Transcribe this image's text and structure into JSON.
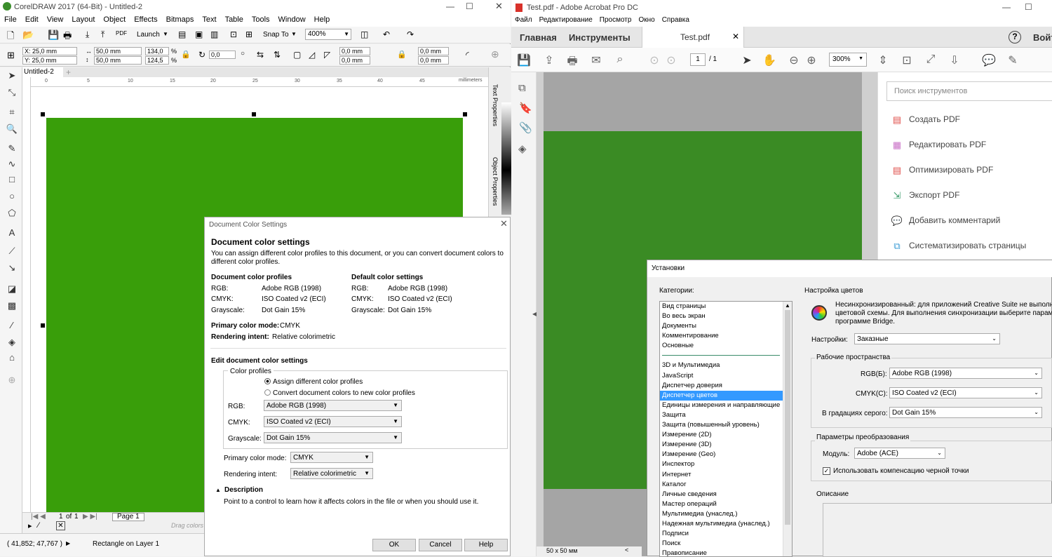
{
  "corel": {
    "title": "CorelDRAW 2017 (64-Bit) - Untitled-2",
    "menu": [
      "File",
      "Edit",
      "View",
      "Layout",
      "Object",
      "Effects",
      "Bitmaps",
      "Text",
      "Table",
      "Tools",
      "Window",
      "Help"
    ],
    "toolbar": {
      "launch": "Launch",
      "snap_to": "Snap To",
      "zoom": "400%"
    },
    "props": {
      "x": "X: 25,0 mm",
      "y": "Y: 25,0 mm",
      "w": "50,0 mm",
      "h": "50,0 mm",
      "sw": "134,0",
      "sh": "124,5",
      "pct": "%",
      "rot": "0,0",
      "c1": "0,0 mm",
      "c2": "0,0 mm",
      "c3": "0,0 mm",
      "c4": "0,0 mm"
    },
    "doc_tab": "Untitled-2",
    "ruler_unit": "millimeters",
    "ruler_ticks": [
      "0",
      "5",
      "10",
      "15",
      "20",
      "25",
      "30",
      "35",
      "40",
      "45"
    ],
    "right_tabs": [
      "Text Properties",
      "Object Properties"
    ],
    "pager": {
      "current": "1",
      "of": "of",
      "total": "1",
      "page_tab": "Page 1"
    },
    "palette_hint": "Drag colors",
    "status": {
      "coords": "( 41,852; 47,767 )",
      "selection": "Rectangle on Layer 1"
    }
  },
  "dcs_dialog": {
    "window_title": "Document Color Settings",
    "heading": "Document color settings",
    "intro": "You can assign different color profiles to this document, or you can convert document colors to different color profiles.",
    "doc_profiles_title": "Document color profiles",
    "default_settings_title": "Default color settings",
    "doc_profiles": [
      {
        "k": "RGB:",
        "v": "Adobe RGB (1998)"
      },
      {
        "k": "CMYK:",
        "v": "ISO Coated v2 (ECI)"
      },
      {
        "k": "Grayscale:",
        "v": "Dot Gain 15%"
      }
    ],
    "default_profiles": [
      {
        "k": "RGB:",
        "v": "Adobe RGB (1998)"
      },
      {
        "k": "CMYK:",
        "v": "ISO Coated v2 (ECI)"
      },
      {
        "k": "Grayscale:",
        "v": "Dot Gain 15%"
      }
    ],
    "primary_mode_label": "Primary color mode:",
    "primary_mode": "CMYK",
    "intent_label": "Rendering intent:",
    "intent": "Relative colorimetric",
    "edit_title": "Edit document color settings",
    "profiles_group": "Color profiles",
    "radio_assign": "Assign different color profiles",
    "radio_convert": "Convert document colors to new color profiles",
    "rgb_label": "RGB:",
    "rgb_value": "Adobe RGB (1998)",
    "cmyk_label": "CMYK:",
    "cmyk_value": "ISO Coated v2 (ECI)",
    "gray_label": "Grayscale:",
    "gray_value": "Dot Gain 15%",
    "primary_mode_value": "CMYK",
    "intent_value": "Relative colorimetric",
    "description_label": "Description",
    "description_text": "Point to a control to learn how it affects colors in the file or when you should use it.",
    "ok": "OK",
    "cancel": "Cancel",
    "help": "Help"
  },
  "acrobat": {
    "title": "Test.pdf - Adobe Acrobat Pro DC",
    "menu": [
      "Файл",
      "Редактирование",
      "Просмотр",
      "Окно",
      "Справка"
    ],
    "tabs": {
      "home": "Главная",
      "tools": "Инструменты",
      "doc": "Test.pdf"
    },
    "signin": "Войт",
    "page_num": "1",
    "page_total": "/ 1",
    "zoom": "300%",
    "page_size": "50 x 50 мм",
    "search_placeholder": "Поиск инструментов",
    "tools": [
      "Создать PDF",
      "Редактировать PDF",
      "Оптимизировать PDF",
      "Экспорт PDF",
      "Добавить комментарий",
      "Систематизировать страницы"
    ],
    "tool_colors": [
      "#e0504c",
      "#c970c6",
      "#e0504c",
      "#3b9c6b",
      "#f0b400",
      "#3a9bd5"
    ]
  },
  "prefs": {
    "title": "Установки",
    "categories_label": "Категории:",
    "categories_top": [
      "Вид страницы",
      "Во весь экран",
      "Документы",
      "Комментирование",
      "Основные"
    ],
    "categories": [
      "3D и Мультимедиа",
      "JavaScript",
      "Диспетчер доверия",
      "Диспетчер цветов",
      "Единицы измерения и направляющие",
      "Защита",
      "Защита (повышенный уровень)",
      "Измерение (2D)",
      "Измерение (3D)",
      "Измерение (Geo)",
      "Инспектор",
      "Интернет",
      "Каталог",
      "Личные сведения",
      "Мастер операций",
      "Мультимедиа (унаслед.)",
      "Надежная мультимедиа (унаслед.)",
      "Подписи",
      "Поиск",
      "Правописание"
    ],
    "color_settings_title": "Настройка цветов",
    "unsync_text_1": "Несинхронизированный: для приложений Creative Suite не выполнеет",
    "unsync_text_2": "цветовой схемы. Для выполнения синхронизации выберите параметр S",
    "unsync_text_3": "программе Bridge.",
    "settings_label": "Настройки:",
    "settings_value": "Заказные",
    "workspaces_title": "Рабочие пространства",
    "rgb_label": "RGB(Б):",
    "rgb_value": "Adobe RGB (1998)",
    "cmyk_label": "CMYK(С):",
    "cmyk_value": "ISO Coated v2 (ECI)",
    "gray_label": "В градациях серого:",
    "gray_value": "Dot Gain 15%",
    "conversion_title": "Параметры преобразования",
    "module_label": "Модуль:",
    "module_value": "Adobe (ACE)",
    "bpc_label": "Использовать компенсацию черной точки",
    "description_title": "Описание"
  }
}
